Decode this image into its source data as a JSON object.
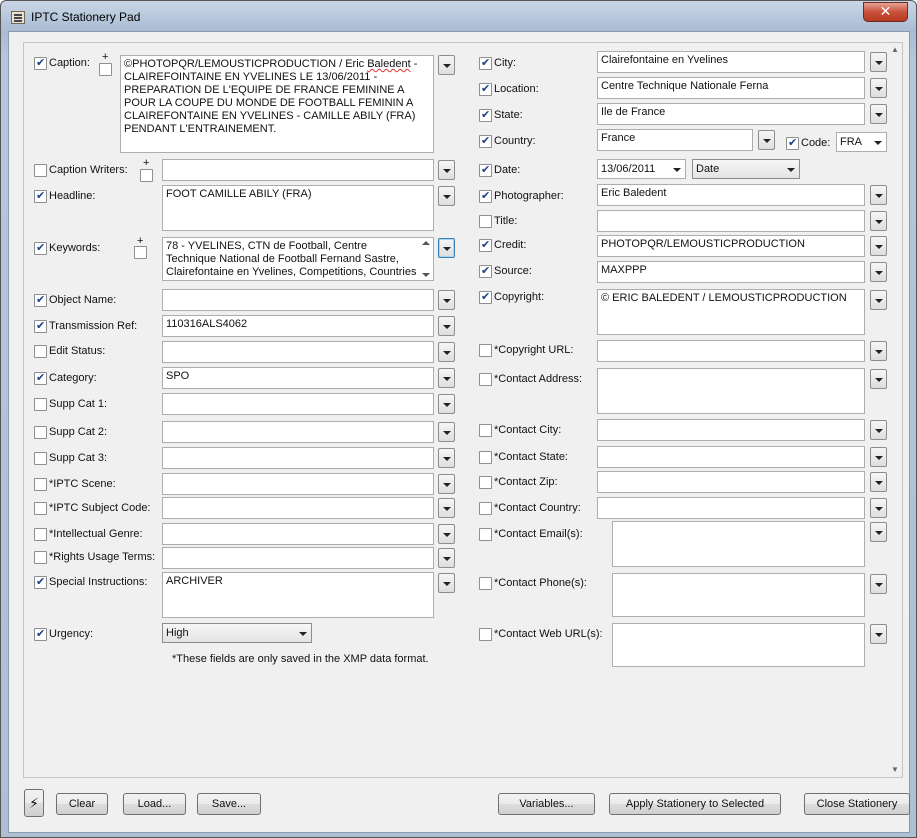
{
  "window": {
    "title": "IPTC Stationery Pad",
    "close_glyph": "✕"
  },
  "left_fields": {
    "caption": {
      "label": "Caption:",
      "checked": true,
      "plus": "+",
      "value_pre": "©PHOTOPQR/LEMOUSTICPRODUCTION / Eric ",
      "value_spell": "Baledent",
      "value_post": " -\nCLAIREFOINTAINE EN YVELINES LE 13/06/2011 -\nPREPARATION DE L'EQUIPE DE FRANCE FEMININE A POUR LA COUPE DU MONDE DE FOOTBALL FEMININ A CLAIREFONTAINE EN YVELINES - CAMILLE ABILY (FRA) PENDANT L'ENTRAINEMENT."
    },
    "caption_writers": {
      "label": "Caption Writers:",
      "checked": false,
      "plus": "+",
      "value": ""
    },
    "headline": {
      "label": "Headline:",
      "checked": true,
      "value": "FOOT CAMILLE ABILY (FRA)"
    },
    "keywords": {
      "label": "Keywords:",
      "checked": true,
      "plus": "+",
      "value": "78 - YVELINES, CTN de Football, Centre Technique National de Football Fernand Sastre, Clairefontaine en Yvelines, Competitions, Countries & Places,"
    },
    "object_name": {
      "label": "Object Name:",
      "checked": true,
      "value": ""
    },
    "transmission_ref": {
      "label": "Transmission Ref:",
      "checked": true,
      "value": "110316ALS4062"
    },
    "edit_status": {
      "label": "Edit Status:",
      "checked": false,
      "value": ""
    },
    "category": {
      "label": "Category:",
      "checked": true,
      "value": "SPO"
    },
    "supp_cat_1": {
      "label": "Supp Cat 1:",
      "checked": false,
      "value": ""
    },
    "supp_cat_2": {
      "label": "Supp Cat 2:",
      "checked": false,
      "value": ""
    },
    "supp_cat_3": {
      "label": "Supp Cat 3:",
      "checked": false,
      "value": ""
    },
    "iptc_scene": {
      "label": "*IPTC Scene:",
      "checked": false,
      "value": ""
    },
    "iptc_subject_code": {
      "label": "*IPTC Subject Code:",
      "checked": false,
      "value": ""
    },
    "intellectual_genre": {
      "label": "*Intellectual Genre:",
      "checked": false,
      "value": ""
    },
    "rights_usage_terms": {
      "label": "*Rights Usage Terms:",
      "checked": false,
      "value": ""
    },
    "special_instructions": {
      "label": "Special Instructions:",
      "checked": true,
      "value": "ARCHIVER"
    },
    "urgency": {
      "label": "Urgency:",
      "checked": true,
      "value": "High"
    }
  },
  "note": "*These fields are only saved in the XMP data format.",
  "right_fields": {
    "city": {
      "label": "City:",
      "checked": true,
      "value": "Clairefontaine en Yvelines"
    },
    "location": {
      "label": "Location:",
      "checked": true,
      "value": "Centre Technique Nationale Ferna"
    },
    "state": {
      "label": "State:",
      "checked": true,
      "value": "Ile de France"
    },
    "country": {
      "label": "Country:",
      "checked": true,
      "value": "France"
    },
    "code": {
      "label": "Code:",
      "checked": true,
      "value": "FRA"
    },
    "date": {
      "label": "Date:",
      "checked": true,
      "value": "13/06/2011",
      "mode": "Date"
    },
    "photographer": {
      "label": "Photographer:",
      "checked": true,
      "value": "Eric Baledent"
    },
    "title": {
      "label": "Title:",
      "checked": false,
      "value": ""
    },
    "credit": {
      "label": "Credit:",
      "checked": true,
      "value": "PHOTOPQR/LEMOUSTICPRODUCTION"
    },
    "source": {
      "label": "Source:",
      "checked": true,
      "value": "MAXPPP"
    },
    "copyright": {
      "label": "Copyright:",
      "checked": true,
      "value": "© ERIC BALEDENT / LEMOUSTICPRODUCTION"
    },
    "copyright_url": {
      "label": "*Copyright URL:",
      "checked": false,
      "value": ""
    },
    "contact_address": {
      "label": "*Contact Address:",
      "checked": false,
      "value": ""
    },
    "contact_city": {
      "label": "*Contact City:",
      "checked": false,
      "value": ""
    },
    "contact_state": {
      "label": "*Contact State:",
      "checked": false,
      "value": ""
    },
    "contact_zip": {
      "label": "*Contact Zip:",
      "checked": false,
      "value": ""
    },
    "contact_country": {
      "label": "*Contact Country:",
      "checked": false,
      "value": ""
    },
    "contact_email": {
      "label": "*Contact Email(s):",
      "checked": false,
      "value": ""
    },
    "contact_phone": {
      "label": "*Contact Phone(s):",
      "checked": false,
      "value": ""
    },
    "contact_web": {
      "label": "*Contact Web URL(s):",
      "checked": false,
      "value": ""
    }
  },
  "buttons": {
    "lightning": "⚡",
    "clear": "Clear",
    "load": "Load...",
    "save": "Save...",
    "variables": "Variables...",
    "apply": "Apply Stationery to Selected",
    "close": "Close Stationery"
  }
}
